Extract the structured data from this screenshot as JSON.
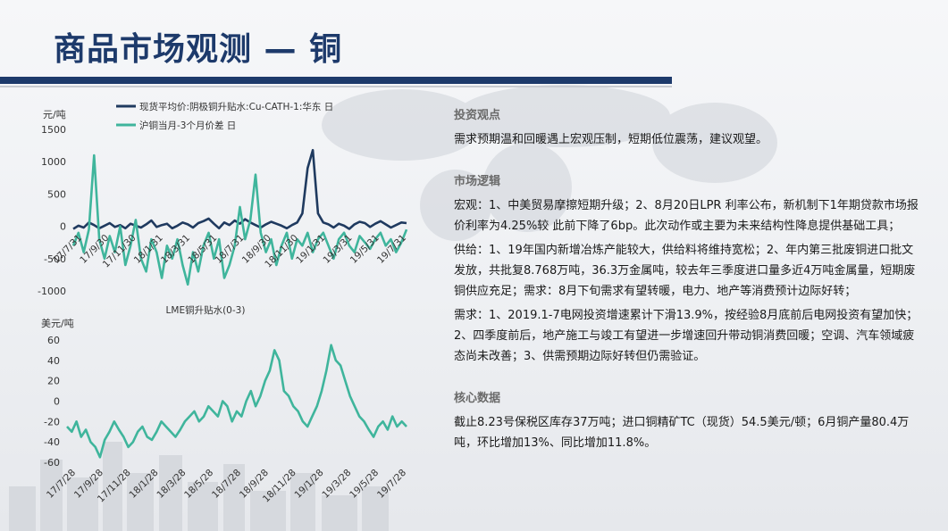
{
  "header": {
    "title": "商品市场观测 — 铜"
  },
  "colors": {
    "navy": "#1d3a6b",
    "series_dark": "#1f3a5f",
    "series_teal": "#3fb59c"
  },
  "chart_data": [
    {
      "type": "line",
      "ylabel": "元/吨",
      "ylim": [
        -1000,
        1500
      ],
      "yticks": [
        "1500",
        "1000",
        "500",
        "0",
        "-500",
        "-1000"
      ],
      "xticks": [
        "17/7/31",
        "17/9/30",
        "17/11/30",
        "18/1/31",
        "18/3/31",
        "18/5/31",
        "18/7/31",
        "18/9/30",
        "18/11/30",
        "19/1/31",
        "19/3/31",
        "19/5/31",
        "19/7/31"
      ],
      "legend": "top",
      "series": [
        {
          "name": "现货平均价:阴极铜升贴水:Cu-CATH-1:华东 日",
          "color": "#1f3a5f",
          "values": [
            -40,
            10,
            -20,
            60,
            20,
            -30,
            10,
            50,
            -10,
            20,
            -30,
            40,
            10,
            -20,
            30,
            90,
            -10,
            20,
            40,
            -30,
            10,
            60,
            30,
            -20,
            50,
            80,
            120,
            40,
            -30,
            60,
            20,
            90,
            40,
            110,
            60,
            20,
            -20,
            30,
            70,
            40,
            10,
            -30,
            20,
            60,
            200,
            900,
            1180,
            200,
            60,
            30,
            -20,
            40,
            10,
            -40,
            30,
            70,
            50,
            -10,
            40,
            80,
            30,
            -20,
            20,
            60,
            50
          ]
        },
        {
          "name": "沪铜当月-3个月价差 日",
          "color": "#3fb59c",
          "values": [
            -300,
            -100,
            -400,
            -50,
            1100,
            -200,
            -500,
            -150,
            -400,
            0,
            -600,
            -300,
            100,
            -500,
            -700,
            -200,
            -400,
            -800,
            -300,
            -500,
            -200,
            -600,
            -900,
            -400,
            -700,
            -300,
            -100,
            -500,
            -200,
            -800,
            -600,
            -300,
            300,
            -200,
            100,
            800,
            -100,
            -400,
            -200,
            -600,
            -300,
            -100,
            -500,
            -200,
            -300,
            -100,
            -400,
            -200,
            -100,
            -300,
            -500,
            -200,
            -100,
            -300,
            -400,
            -150,
            -250,
            -350,
            -200,
            -100,
            -300,
            -200,
            -400,
            -250,
            -50
          ]
        }
      ]
    },
    {
      "type": "line",
      "title": "LME铜升贴水(0-3)",
      "ylabel": "美元/吨",
      "ylim": [
        -60,
        60
      ],
      "yticks": [
        "60",
        "40",
        "20",
        "0",
        "-20",
        "-40",
        "-60"
      ],
      "xticks": [
        "17/7/28",
        "17/9/28",
        "17/11/28",
        "18/1/28",
        "18/3/28",
        "18/5/28",
        "18/7/28",
        "18/9/28",
        "18/11/28",
        "19/1/28",
        "19/3/28",
        "19/5/28",
        "19/7/28"
      ],
      "series": [
        {
          "name": "",
          "color": "#3fb59c",
          "values": [
            -25,
            -30,
            -20,
            -35,
            -28,
            -40,
            -45,
            -55,
            -38,
            -30,
            -20,
            -28,
            -35,
            -45,
            -40,
            -30,
            -25,
            -35,
            -38,
            -30,
            -20,
            -25,
            -30,
            -35,
            -28,
            -20,
            -15,
            -10,
            -20,
            -15,
            -5,
            -10,
            -15,
            0,
            -5,
            -20,
            -10,
            -15,
            0,
            10,
            -5,
            5,
            20,
            30,
            50,
            40,
            10,
            5,
            -5,
            -10,
            -20,
            -25,
            -15,
            -5,
            10,
            30,
            55,
            40,
            35,
            20,
            5,
            -5,
            -15,
            -20,
            -28,
            -35,
            -25,
            -20,
            -28,
            -15,
            -25,
            -20,
            -25
          ]
        }
      ]
    }
  ],
  "right": {
    "s1_title": "投资观点",
    "s1_text": "需求预期温和回暖遇上宏观压制，短期低位震荡，建议观望。",
    "s2_title": "市场逻辑",
    "s2_p1": "宏观：1、中美贸易摩擦短期升级；2、8月20日LPR 利率公布，新机制下1年期贷款市场报价利率为4.25%较 此前下降了6bp。此次动作或主要为未来结构性降息提供基础工具；",
    "s2_p2": "供给：1、19年国内新增冶炼产能较大，供给料将维持宽松；2、年内第三批废铜进口批文发放，共批复8.768万吨，36.3万金属吨，较去年三季度进口量多近4万吨金属量，短期废铜供应充足；需求：8月下旬需求有望转暖，电力、地产等消费预计边际好转；",
    "s2_p3": "需求：1、2019.1-7电网投资增速累计下滑13.9%，按经验8月底前后电网投资有望加快；2、四季度前后，地产施工与竣工有望进一步增速回升带动铜消费回暖；空调、汽车领域疲态尚未改善；3、供需预期边际好转但仍需验证。",
    "s3_title": "核心数据",
    "s3_text": "截止8.23号保税区库存37万吨；进口铜精矿TC（现货）54.5美元/顿；6月铜产量80.4万吨，环比增加13%、同比增加11.8%。"
  }
}
